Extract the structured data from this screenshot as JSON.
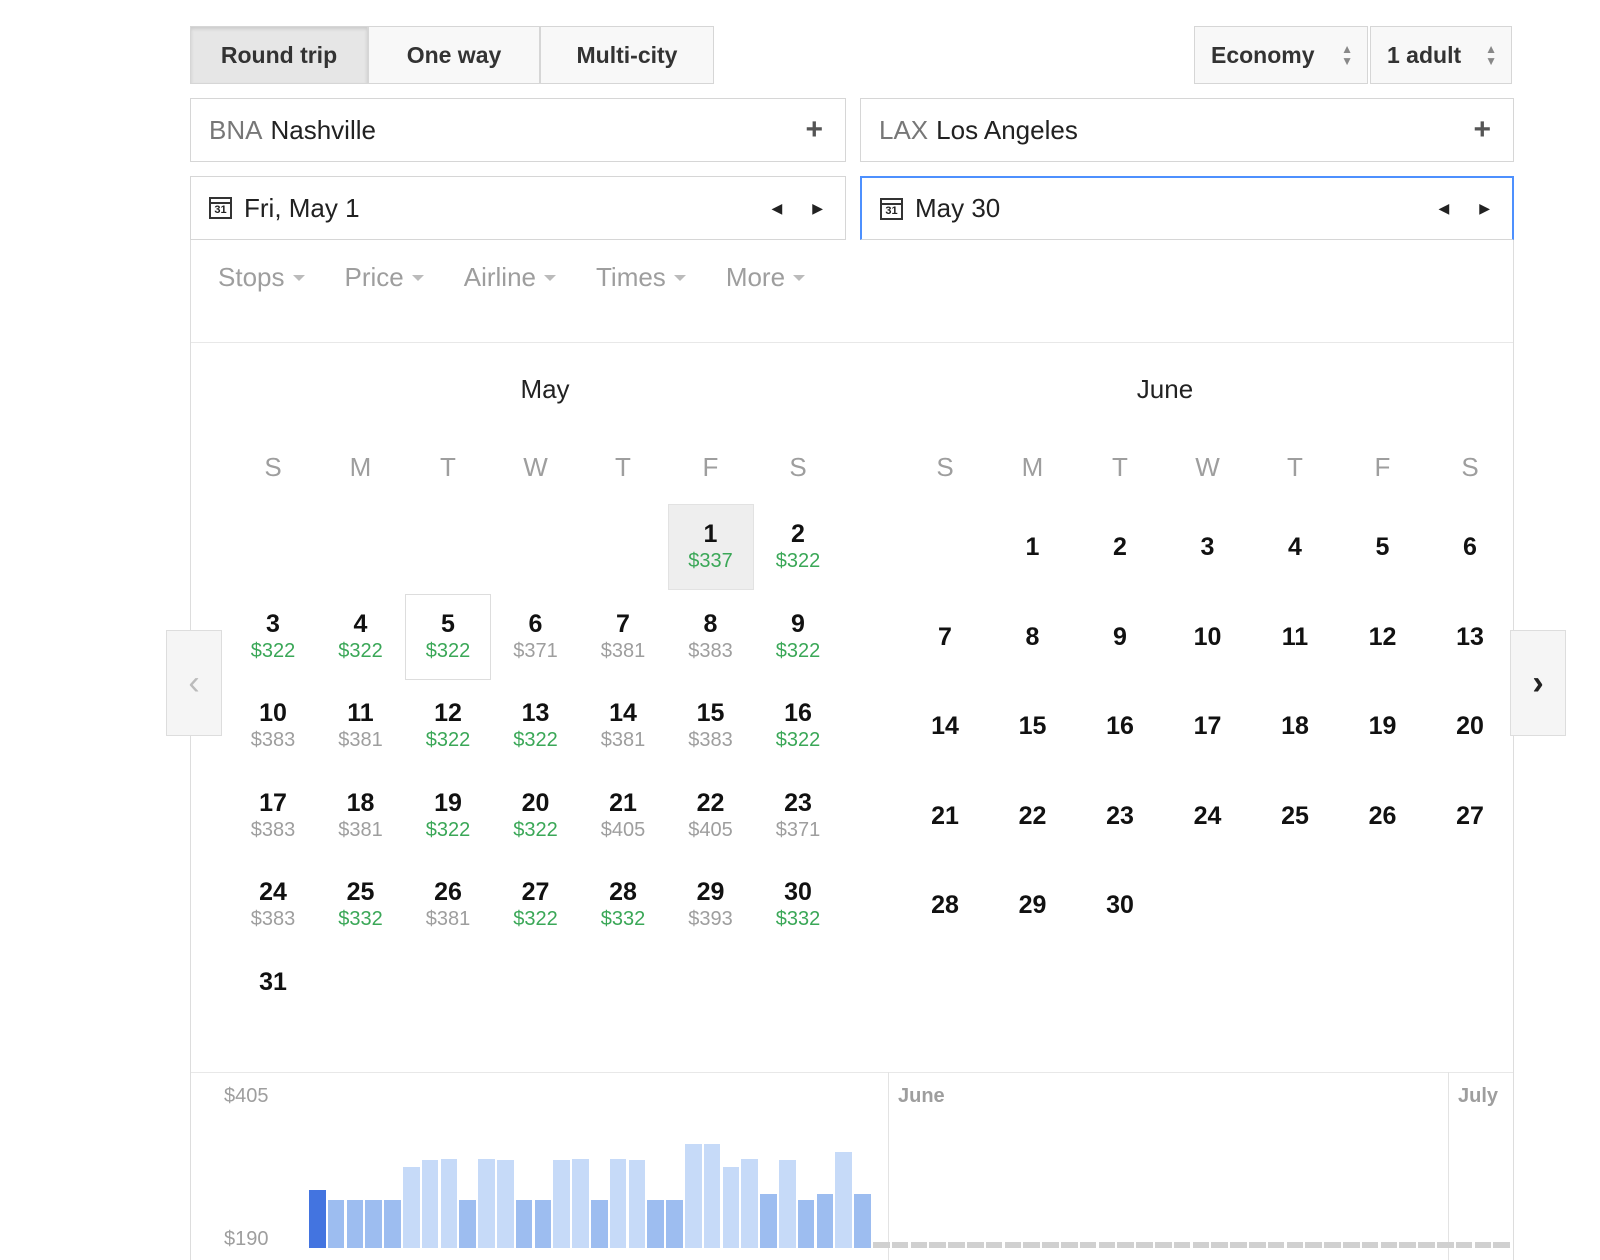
{
  "trip_types": [
    {
      "label": "Round trip",
      "active": true
    },
    {
      "label": "One way",
      "active": false
    },
    {
      "label": "Multi-city",
      "active": false
    }
  ],
  "cabin": {
    "label": "Economy"
  },
  "passengers": {
    "label": "1 adult"
  },
  "origin": {
    "code": "BNA",
    "city": "Nashville"
  },
  "destination": {
    "code": "LAX",
    "city": "Los Angeles"
  },
  "depart_date": "Fri, May 1",
  "return_date": "May 30",
  "filters": [
    "Stops",
    "Price",
    "Airline",
    "Times",
    "More"
  ],
  "weekdays": [
    "S",
    "M",
    "T",
    "W",
    "T",
    "F",
    "S"
  ],
  "months": [
    {
      "name": "May",
      "start_weekday": 5,
      "days": [
        {
          "d": "1",
          "price": "$337",
          "tone": "green",
          "state": "selected"
        },
        {
          "d": "2",
          "price": "$322",
          "tone": "green"
        },
        {
          "d": "3",
          "price": "$322",
          "tone": "green"
        },
        {
          "d": "4",
          "price": "$322",
          "tone": "green"
        },
        {
          "d": "5",
          "price": "$322",
          "tone": "green",
          "state": "outlined"
        },
        {
          "d": "6",
          "price": "$371",
          "tone": "gray"
        },
        {
          "d": "7",
          "price": "$381",
          "tone": "gray"
        },
        {
          "d": "8",
          "price": "$383",
          "tone": "gray"
        },
        {
          "d": "9",
          "price": "$322",
          "tone": "green"
        },
        {
          "d": "10",
          "price": "$383",
          "tone": "gray"
        },
        {
          "d": "11",
          "price": "$381",
          "tone": "gray"
        },
        {
          "d": "12",
          "price": "$322",
          "tone": "green"
        },
        {
          "d": "13",
          "price": "$322",
          "tone": "green"
        },
        {
          "d": "14",
          "price": "$381",
          "tone": "gray"
        },
        {
          "d": "15",
          "price": "$383",
          "tone": "gray"
        },
        {
          "d": "16",
          "price": "$322",
          "tone": "green"
        },
        {
          "d": "17",
          "price": "$383",
          "tone": "gray"
        },
        {
          "d": "18",
          "price": "$381",
          "tone": "gray"
        },
        {
          "d": "19",
          "price": "$322",
          "tone": "green"
        },
        {
          "d": "20",
          "price": "$322",
          "tone": "green"
        },
        {
          "d": "21",
          "price": "$405",
          "tone": "gray"
        },
        {
          "d": "22",
          "price": "$405",
          "tone": "gray"
        },
        {
          "d": "23",
          "price": "$371",
          "tone": "gray"
        },
        {
          "d": "24",
          "price": "$383",
          "tone": "gray"
        },
        {
          "d": "25",
          "price": "$332",
          "tone": "green"
        },
        {
          "d": "26",
          "price": "$381",
          "tone": "gray"
        },
        {
          "d": "27",
          "price": "$322",
          "tone": "green"
        },
        {
          "d": "28",
          "price": "$332",
          "tone": "green"
        },
        {
          "d": "29",
          "price": "$393",
          "tone": "gray"
        },
        {
          "d": "30",
          "price": "$332",
          "tone": "green"
        },
        {
          "d": "31",
          "price": "",
          "tone": "gray"
        }
      ]
    },
    {
      "name": "June",
      "start_weekday": 1,
      "days": [
        {
          "d": "1"
        },
        {
          "d": "2"
        },
        {
          "d": "3"
        },
        {
          "d": "4"
        },
        {
          "d": "5"
        },
        {
          "d": "6"
        },
        {
          "d": "7"
        },
        {
          "d": "8"
        },
        {
          "d": "9"
        },
        {
          "d": "10"
        },
        {
          "d": "11"
        },
        {
          "d": "12"
        },
        {
          "d": "13"
        },
        {
          "d": "14"
        },
        {
          "d": "15"
        },
        {
          "d": "16"
        },
        {
          "d": "17"
        },
        {
          "d": "18"
        },
        {
          "d": "19"
        },
        {
          "d": "20"
        },
        {
          "d": "21"
        },
        {
          "d": "22"
        },
        {
          "d": "23"
        },
        {
          "d": "24"
        },
        {
          "d": "25"
        },
        {
          "d": "26"
        },
        {
          "d": "27"
        },
        {
          "d": "28"
        },
        {
          "d": "29"
        },
        {
          "d": "30"
        }
      ]
    }
  ],
  "price_chart": {
    "y_max_label": "$405",
    "y_min_label": "$190",
    "month_labels": [
      "June",
      "July"
    ],
    "y_range": [
      190,
      405
    ],
    "selected_index": 0,
    "may_prices": [
      337,
      322,
      322,
      322,
      322,
      371,
      381,
      383,
      322,
      383,
      381,
      322,
      322,
      381,
      383,
      322,
      383,
      381,
      322,
      322,
      405,
      405,
      371,
      383,
      332,
      381,
      322,
      332,
      393,
      332
    ],
    "empty_days": 35,
    "colors": {
      "selected": "#4374e0",
      "green": "#9dbdf0",
      "other": "#c6daf8",
      "empty": "#d0d0d0"
    }
  }
}
